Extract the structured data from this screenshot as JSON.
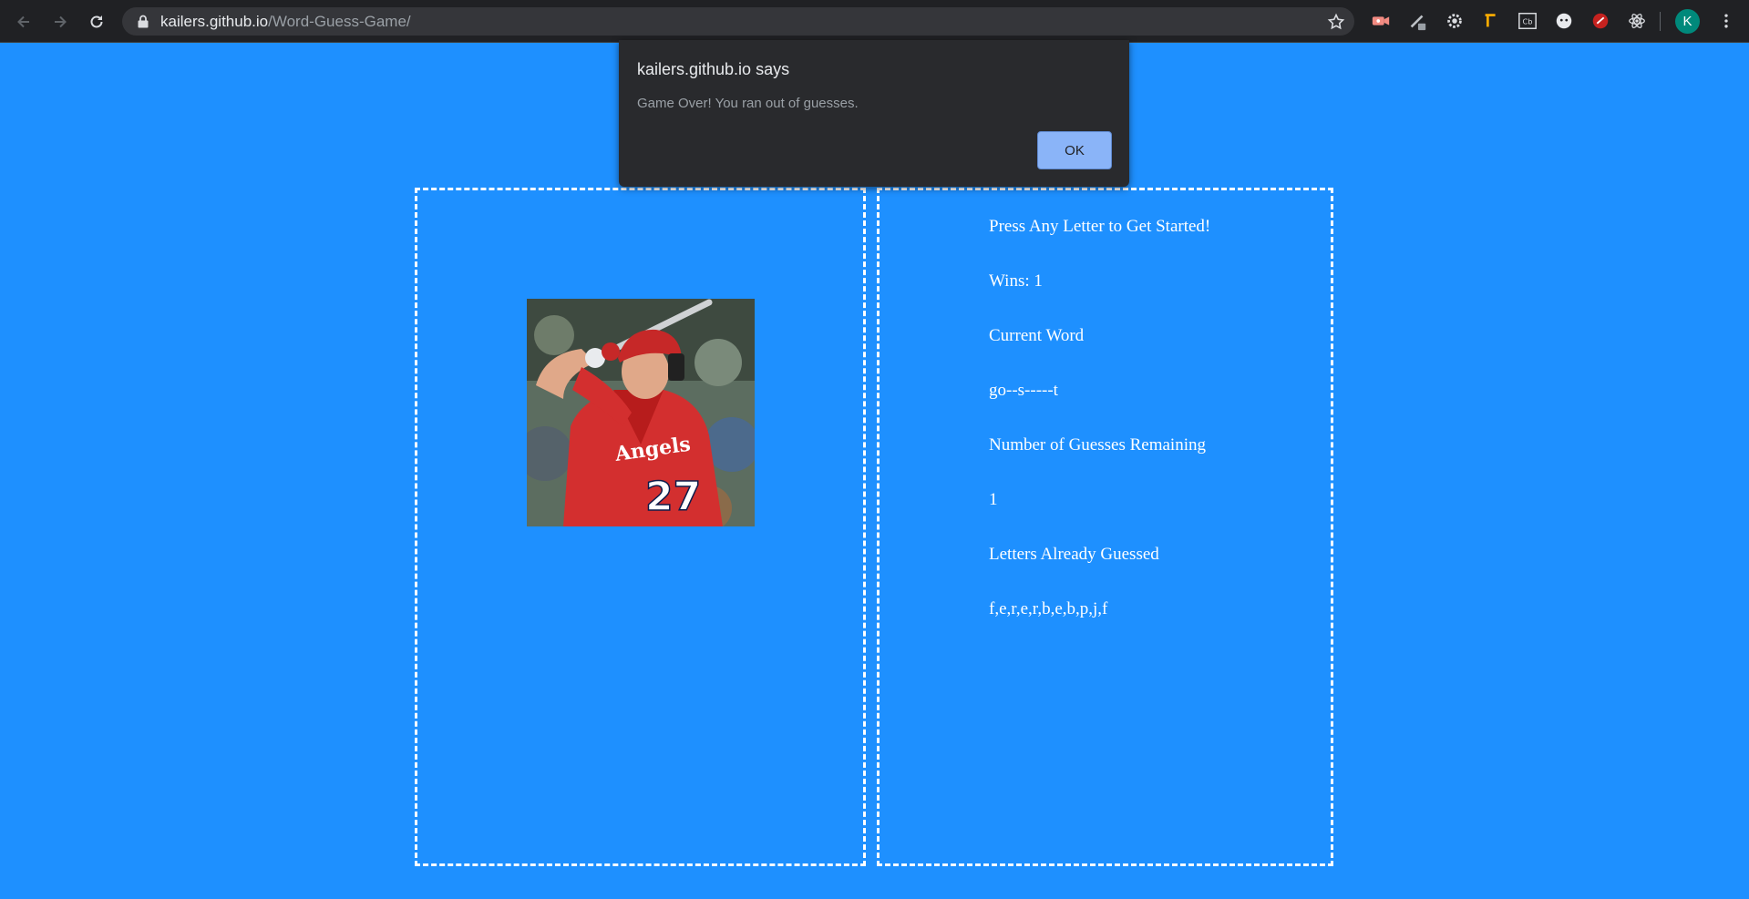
{
  "browser": {
    "url_host": "kailers.github.io",
    "url_path": "/Word-Guess-Game/",
    "profile_initial": "K",
    "extensions": [
      "video-ext-icon",
      "pen-ext-icon",
      "settings-ext-icon",
      "pick-ext-icon",
      "cb-ext-icon",
      "face-ext-icon",
      "red-ext-icon",
      "react-ext-icon"
    ],
    "colors": {
      "chrome": "#202124",
      "omnibox": "#35363a",
      "avatar": "#00897b"
    }
  },
  "page": {
    "background": "#1e90ff",
    "start_prompt": "Press Any Letter to Get Started!",
    "wins": "Wins: 1",
    "current_word_label": "Current Word",
    "current_word": "go--s-----t",
    "guesses_remaining_label": "Number of Guesses Remaining",
    "guesses_remaining": "1",
    "letters_guessed_label": "Letters Already Guessed",
    "letters_guessed": "f,e,r,e,r,b,e,b,p,j,f"
  },
  "dialog": {
    "title": "kailers.github.io says",
    "message": "Game Over! You ran out of guesses.",
    "ok_label": "OK"
  }
}
